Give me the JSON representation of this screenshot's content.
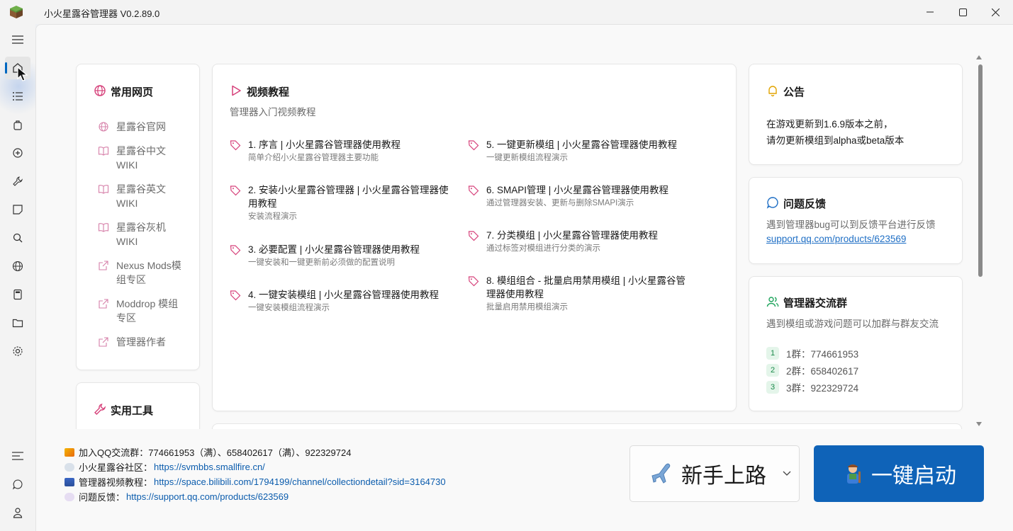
{
  "window": {
    "title": "小火星露谷管理器 V0.2.89.0"
  },
  "nav": {
    "items": [
      "menu-toggle",
      "home",
      "list",
      "bag",
      "mods",
      "wrench",
      "note",
      "search",
      "globe",
      "calculator",
      "folder",
      "settings"
    ],
    "bottom": [
      "notes-list",
      "feedback",
      "account"
    ]
  },
  "common_pages": {
    "title": "常用网页",
    "items": [
      {
        "label": "星露谷官网",
        "icon": "globe-icon"
      },
      {
        "label": "星露谷中文WIKI",
        "icon": "book-icon"
      },
      {
        "label": "星露谷英文WIKI",
        "icon": "book-icon"
      },
      {
        "label": "星露谷灰机WIKI",
        "icon": "book-icon"
      },
      {
        "label": "Nexus Mods模组专区",
        "icon": "external-link-icon"
      },
      {
        "label": "Moddrop 模组专区",
        "icon": "external-link-icon"
      },
      {
        "label": "管理器作者",
        "icon": "external-link-icon"
      }
    ]
  },
  "tools": {
    "title": "实用工具"
  },
  "videos": {
    "title": "视频教程",
    "subtitle": "管理器入门视频教程",
    "items": [
      {
        "title": "1. 序言 | 小火星露谷管理器使用教程",
        "desc": "简单介绍小火星露谷管理器主要功能"
      },
      {
        "title": "2. 安装小火星露谷管理器 | 小火星露谷管理器使用教程",
        "desc": "安装流程演示"
      },
      {
        "title": "3. 必要配置 | 小火星露谷管理器使用教程",
        "desc": "一键安装和一键更新前必须做的配置说明"
      },
      {
        "title": "4. 一键安装模组 | 小火星露谷管理器使用教程",
        "desc": "一键安装模组流程演示"
      },
      {
        "title": "5. 一键更新模组 | 小火星露谷管理器使用教程",
        "desc": "一键更新模组流程演示"
      },
      {
        "title": "6. SMAPI管理 | 小火星露谷管理器使用教程",
        "desc": "通过管理器安装、更新与删除SMAPI演示"
      },
      {
        "title": "7. 分类模组 | 小火星露谷管理器使用教程",
        "desc": "通过标签对模组进行分类的演示"
      },
      {
        "title": "8. 模组组合 - 批量启用禁用模组 | 小火星露谷管理器使用教程",
        "desc": "批量启用禁用模组演示"
      }
    ]
  },
  "announcement": {
    "title": "公告",
    "line1": "在游戏更新到1.6.9版本之前，",
    "line2": "请勿更新模组到alpha或beta版本"
  },
  "feedback": {
    "title": "问题反馈",
    "text": "遇到管理器bug可以到反馈平台进行反馈",
    "link": "support.qq.com/products/623569"
  },
  "groups": {
    "title": "管理器交流群",
    "text": "遇到模组或游戏问题可以加群与群友交流",
    "items": [
      {
        "num": "1",
        "label": "1群：774661953"
      },
      {
        "num": "2",
        "label": "2群：658402617"
      },
      {
        "num": "3",
        "label": "3群：922329724"
      }
    ]
  },
  "bottom_info": {
    "qq": {
      "label": "加入QQ交流群：",
      "value": "774661953（满）、658402617（满）、922329724"
    },
    "community": {
      "label": "小火星露谷社区：",
      "url": "https://svmbbs.smallfire.cn/"
    },
    "tutorial": {
      "label": "管理器视频教程：",
      "url": "https://space.bilibili.com/1794199/channel/collectiondetail?sid=3164730"
    },
    "feedback": {
      "label": "问题反馈：",
      "url": "https://support.qq.com/products/623569"
    }
  },
  "buttons": {
    "newbie": "新手上路",
    "launch": "一键启动"
  },
  "colors": {
    "accent": "#0f63b8",
    "pink": "#d6417a",
    "link": "#0b5cad"
  }
}
